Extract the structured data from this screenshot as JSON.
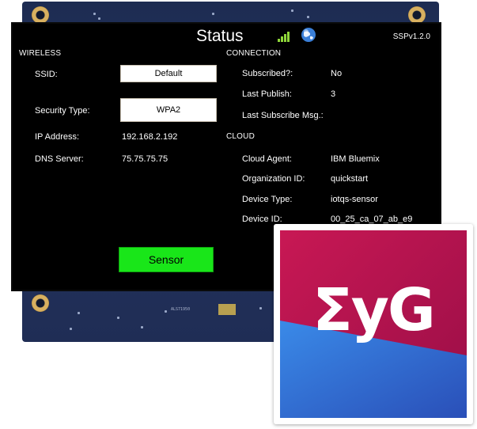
{
  "screen": {
    "title": "Status",
    "version": "SSPv1.2.0",
    "wireless": {
      "heading": "WIRELESS",
      "ssid_label": "SSID:",
      "ssid_value": "Default",
      "security_label": "Security Type:",
      "security_value": "WPA2",
      "ip_label": "IP Address:",
      "ip_value": "192.168.2.192",
      "dns_label": "DNS Server:",
      "dns_value": "75.75.75.75"
    },
    "connection": {
      "heading": "CONNECTION",
      "subscribed_label": "Subscribed?:",
      "subscribed_value": "No",
      "last_publish_label": "Last Publish:",
      "last_publish_value": "3",
      "last_subscribe_label": "Last Subscribe Msg.:",
      "last_subscribe_value": ""
    },
    "cloud": {
      "heading": "CLOUD",
      "agent_label": "Cloud Agent:",
      "agent_value": "IBM Bluemix",
      "org_label": "Organization ID:",
      "org_value": "quickstart",
      "device_type_label": "Device Type:",
      "device_type_value": "iotqs-sensor",
      "device_id_label": "Device ID:",
      "device_id_value": "00_25_ca_07_ab_e9"
    },
    "sensor_button": "Sensor",
    "icons": [
      "signal-bars-icon",
      "globe-icon"
    ]
  },
  "logo": {
    "text": "ΣyG",
    "colors": {
      "top": "#b0124f",
      "bottom": "#2f6fd0"
    }
  },
  "board": {
    "chip_marking": "ALS71950"
  }
}
